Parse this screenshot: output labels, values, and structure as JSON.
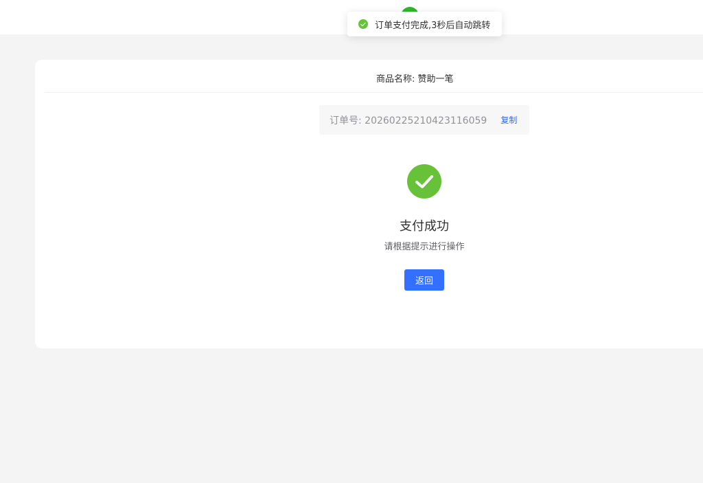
{
  "toast": {
    "icon": "check-circle-icon",
    "message": "订单支付完成,3秒后自动跳转",
    "color": "#67c23a"
  },
  "product": {
    "name_label": "商品名称: 赞助一笔"
  },
  "order": {
    "number_label": "订单号: 20260225210423116059",
    "copy_label": "复制"
  },
  "result": {
    "icon": "success-check-icon",
    "title": "支付成功",
    "subtitle": "请根据提示进行操作",
    "back_label": "返回"
  },
  "colors": {
    "success": "#67c23a",
    "primary": "#3370ff",
    "link": "#2f6bf0"
  }
}
